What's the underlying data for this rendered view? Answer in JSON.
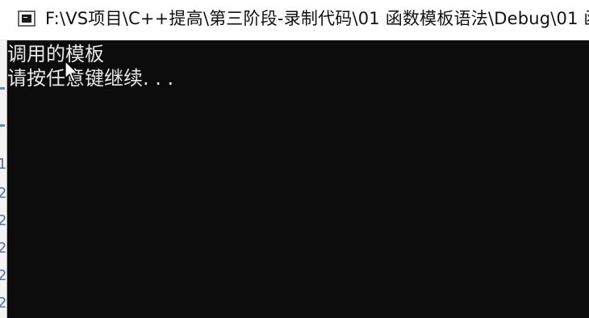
{
  "window": {
    "title": "F:\\VS项目\\C++提高\\第三阶段-录制代码\\01 函数模板语法\\Debug\\01 函"
  },
  "console": {
    "lines": [
      "调用的模板",
      "请按任意键继续. . ."
    ]
  },
  "background_window": {
    "visible_digits": [
      "1",
      "2",
      "2",
      "2",
      "2",
      "2"
    ]
  },
  "colors": {
    "console_background": "#0c0c0c",
    "console_text": "#e8e8e8",
    "titlebar_background": "#ffffff"
  },
  "icons": {
    "app": "console-window-icon",
    "pointer": "mouse-cursor-icon"
  }
}
